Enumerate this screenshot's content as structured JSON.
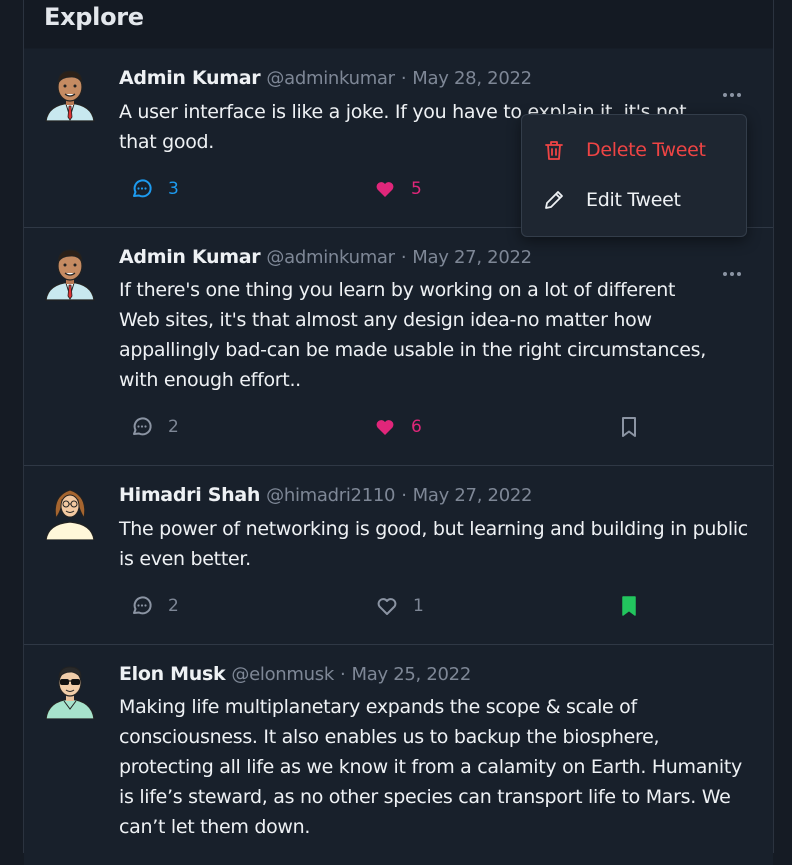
{
  "header": {
    "title": "Explore"
  },
  "tweets": [
    {
      "name": "Admin Kumar",
      "handle": "@adminkumar",
      "separator": "·",
      "date": "May 28, 2022",
      "text": "A user interface is like a joke. If you have to explain it, it's not that good.",
      "replies": "3",
      "likes": "5",
      "liked": true,
      "bookmarked": false
    },
    {
      "name": "Admin Kumar",
      "handle": "@adminkumar",
      "separator": "·",
      "date": "May 27, 2022",
      "text": "If there's one thing you learn by working on a lot of different Web sites, it's that almost any design idea-no matter how appallingly bad-can be made usable in the right circumstances, with enough effort..",
      "replies": "2",
      "likes": "6",
      "liked": true,
      "bookmarked": false
    },
    {
      "name": "Himadri Shah",
      "handle": "@himadri2110",
      "separator": "·",
      "date": "May 27, 2022",
      "text": "The power of networking is good, but learning and building in public is even better.",
      "replies": "2",
      "likes": "1",
      "liked": false,
      "bookmarked": true
    },
    {
      "name": "Elon Musk",
      "handle": "@elonmusk",
      "separator": "·",
      "date": "May 25, 2022",
      "text": "Making life multiplanetary expands the scope & scale of consciousness. It also enables us to backup the biosphere, protecting all life as we know it from a calamity on Earth. Humanity is life’s steward, as no other species can transport life to Mars. We can’t let them down."
    }
  ],
  "menu": {
    "delete_label": "Delete Tweet",
    "edit_label": "Edit Tweet"
  },
  "colors": {
    "like": "#e0267a",
    "reply_active": "#1d9bf0",
    "bookmark_active": "#22c55e",
    "danger": "#ef4444",
    "muted": "#7e8796"
  },
  "icons": [
    "avatar-icon",
    "more-options-icon",
    "comment-icon",
    "heart-icon",
    "bookmark-icon",
    "trash-icon",
    "pencil-icon"
  ]
}
